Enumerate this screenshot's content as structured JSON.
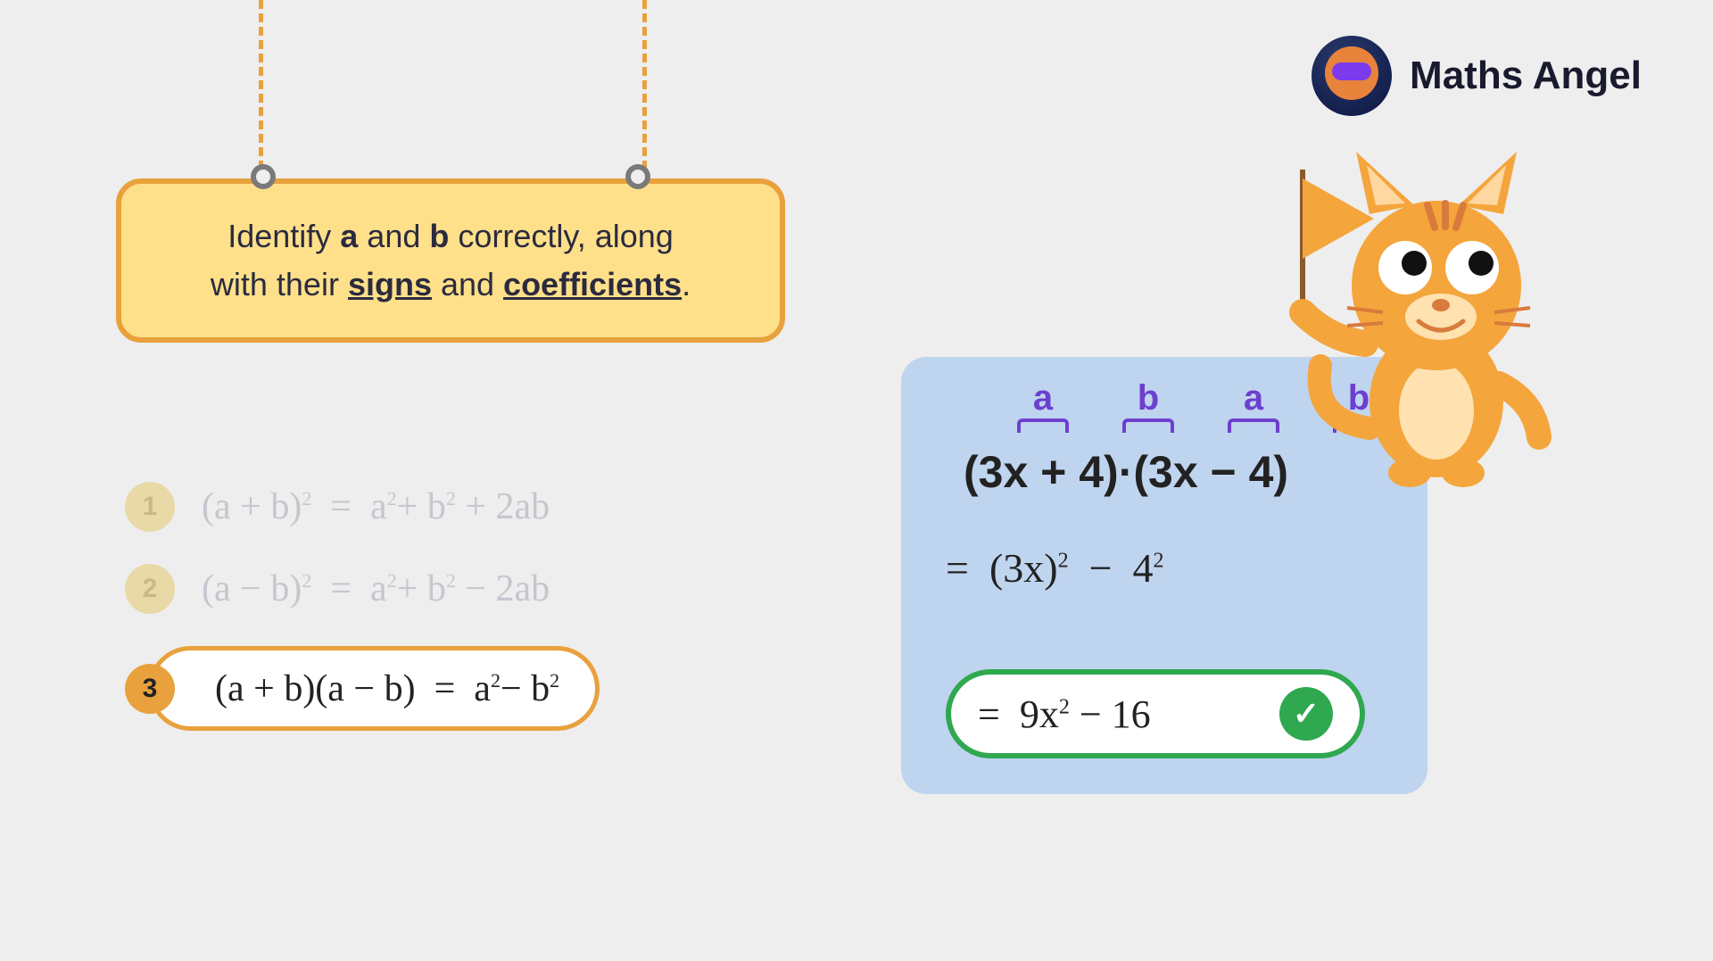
{
  "brand": {
    "name": "Maths Angel"
  },
  "tip": {
    "line1_pre": "Identify ",
    "a": "a",
    "mid1": " and ",
    "b": "b",
    "line1_post": " correctly, along",
    "line2_pre": "with their ",
    "u1": "signs",
    "mid2": " and ",
    "u2": "coefficients",
    "line2_post": "."
  },
  "formulas": [
    {
      "num": "1",
      "text": "(a + b)²  =  a² + b² + 2ab",
      "active": false
    },
    {
      "num": "2",
      "text": "(a − b)²  =  a² + b² − 2ab",
      "active": false
    },
    {
      "num": "3",
      "text": "(a + b)(a − b)  =  a² − b²",
      "active": true
    }
  ],
  "panel": {
    "labels": [
      "a",
      "b",
      "a",
      "b"
    ],
    "expression": "(3x + 4)·(3x − 4)",
    "step1": "=  (3x)²  −  4²",
    "answer_prefix": "=  ",
    "answer": "9x²  −  16"
  }
}
